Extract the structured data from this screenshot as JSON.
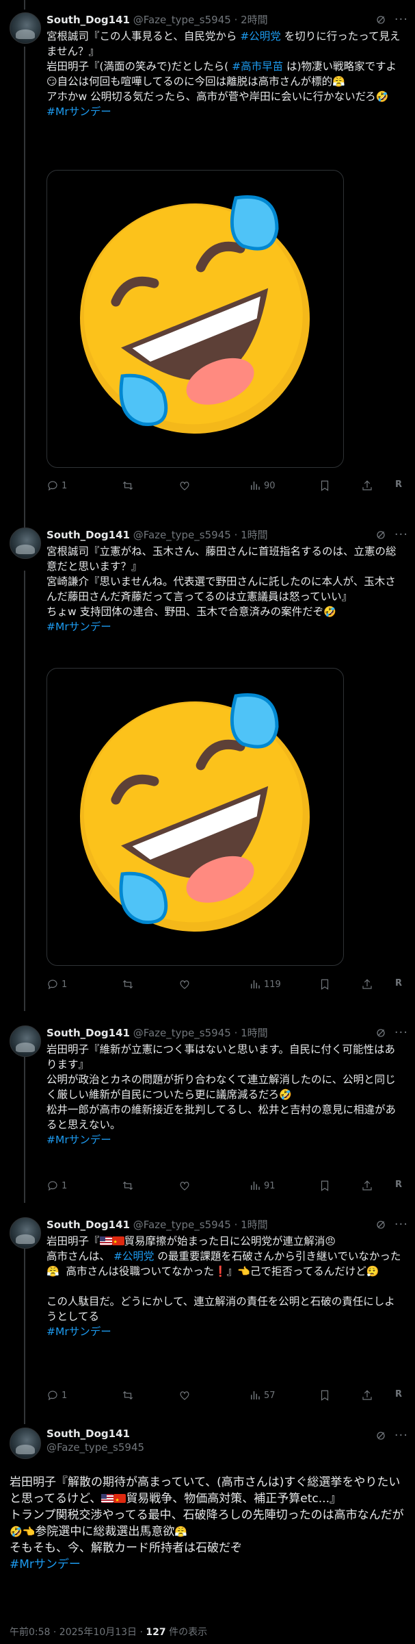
{
  "tweets": [
    {
      "name": "South_Dog141",
      "handle": "@Faze_type_s5945",
      "time": "2時間",
      "replies": "1",
      "views": "90"
    },
    {
      "name": "South_Dog141",
      "handle": "@Faze_type_s5945",
      "time": "1時間",
      "replies": "1",
      "views": "119"
    },
    {
      "name": "South_Dog141",
      "handle": "@Faze_type_s5945",
      "time": "1時間",
      "replies": "1",
      "views": "91"
    },
    {
      "name": "South_Dog141",
      "handle": "@Faze_type_s5945",
      "time": "1時間",
      "replies": "1",
      "views": "57"
    }
  ],
  "t1": {
    "a": "宮根誠司『この人事見ると、自民党から ",
    "tag1": "#公明党",
    "b": " を切りに行ったって見えません？』\n岩田明子『(満面の笑みで)だとしたら( ",
    "tag2": "#高市早苗",
    "c": " は)物凄い戦略家ですよ",
    "d": "自公は何回も喧嘩してるのに今回は離脱は高市さんが標的",
    "e": "\nアホかw 公明切る気だったら、高市が菅や岸田に会いに行かないだろ",
    "tag3": "#Mrサンデー"
  },
  "t2": {
    "a": "宮根誠司『立憲がね、玉木さん、藤田さんに首班指名するのは、立憲の総意だと思います？』\n宮崎謙介『思いませんね。代表選で野田さんに託したのに本人が、玉木さんだ藤田さんだ斉藤だって言ってるのは立憲議員は怒っていい』\nちょw 支持団体の連合、野田、玉木で合意済みの案件だぞ",
    "tag": "#Mrサンデー"
  },
  "t3": {
    "a": "岩田明子『維新が立憲につく事はないと思います。自民に付く可能性はあります』\n公明が政治とカネの問題が折り合わなくて連立解消したのに、公明と同じく厳しい維新が自民についたら更に議席減るだろ",
    "b": "\n松井一郎が高市の維新接近を批判してるし、松井と吉村の意見に相違があると思えない。",
    "tag": "#Mrサンデー"
  },
  "t4": {
    "a": "岩田明子『",
    "b": "貿易摩擦が始まった日に公明党が連立解消",
    "c": "\n高市さんは、 ",
    "tag1": "#公明党",
    "d": " の最重要課題を石破さんから引き継いでいなかった",
    "e": "  高市さんは役職ついてなかった",
    "f": "』",
    "g": "己で拒否ってるんだけど",
    "h": "\n\nこの人駄目だ。どうにかして、連立解消の責任を公明と石破の責任にしようとしてる",
    "tag2": "#Mrサンデー"
  },
  "main": {
    "name": "South_Dog141",
    "handle": "@Faze_type_s5945",
    "a": "岩田明子『解散の期待が高まっていて、(高市さんは)すぐ総選挙をやりたいと思ってるけど、",
    "b": "貿易戦争、物価高対策、補正予算etc...』\nトランプ関税交渉やってる最中、石破降ろしの先陣切ったのは高市なんだが",
    "c": "参院選中に総裁選出馬意欲",
    "d": "\nそもそも、今、解散カード所持者は石破だぞ",
    "tag": "#Mrサンデー",
    "time": "午前0:58 · 2025年10月13日 · ",
    "views": "127",
    "views_suffix": " 件の表示"
  },
  "emoji": {
    "sweat_smile": "😏",
    "huff": "😤",
    "rofl": "🤣",
    "angry": "😠",
    "exclaim": "❗",
    "point": "👈",
    "tired": "😮‍💨"
  },
  "action_icons": [
    "reply-icon",
    "repost-icon",
    "like-icon",
    "views-icon",
    "bookmark-icon",
    "share-icon"
  ],
  "colors": {
    "background": "#000000",
    "text": "#e7e9ea",
    "secondary": "#71767b",
    "accent": "#1d9bf0",
    "border": "#2f3336"
  }
}
